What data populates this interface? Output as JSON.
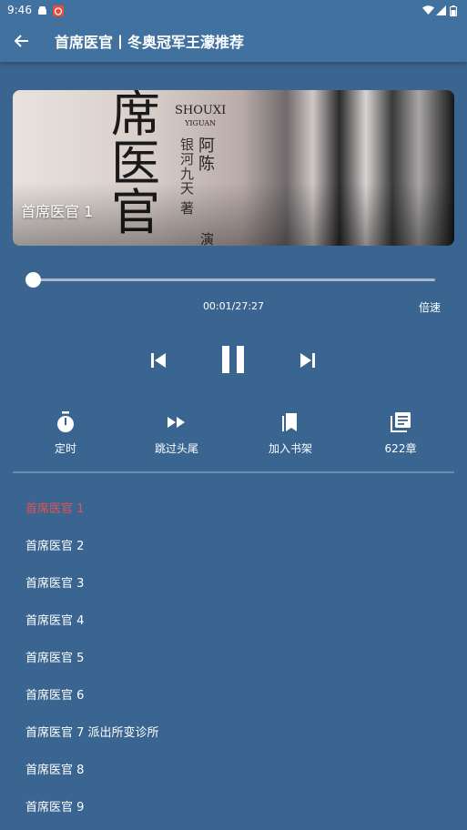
{
  "status_bar": {
    "time": "9:46"
  },
  "app_bar": {
    "title": "首席医官丨冬奥冠军王濛推荐"
  },
  "cover": {
    "caption": "首席医官 1",
    "art_title_chars": [
      "席",
      "医",
      "官"
    ],
    "art_latin_1": "SHOUXI",
    "art_latin_2": "YIGUAN",
    "art_author_1": [
      "阿",
      "陈"
    ],
    "art_author_2": [
      "银",
      "河",
      "九",
      "天"
    ],
    "art_author_suffix": "著",
    "art_extra": "演"
  },
  "player": {
    "progress": 0.006,
    "time_text": "00:01/27:27",
    "speed_label": "倍速"
  },
  "actions": [
    {
      "label": "定时",
      "icon": "timer-icon"
    },
    {
      "label": "跳过头尾",
      "icon": "fast-forward-icon"
    },
    {
      "label": "加入书架",
      "icon": "bookmarks-icon"
    },
    {
      "label": "622章",
      "icon": "library-books-icon"
    }
  ],
  "chapters": [
    "首席医官 1",
    "首席医官 2",
    "首席医官 3",
    "首席医官 4",
    "首席医官 5",
    "首席医官 6",
    "首席医官 7 派出所变诊所",
    "首席医官 8",
    "首席医官 9"
  ],
  "active_chapter_index": 0,
  "colors": {
    "background": "#3a6590",
    "bar": "#41729f",
    "active": "#e25252"
  }
}
